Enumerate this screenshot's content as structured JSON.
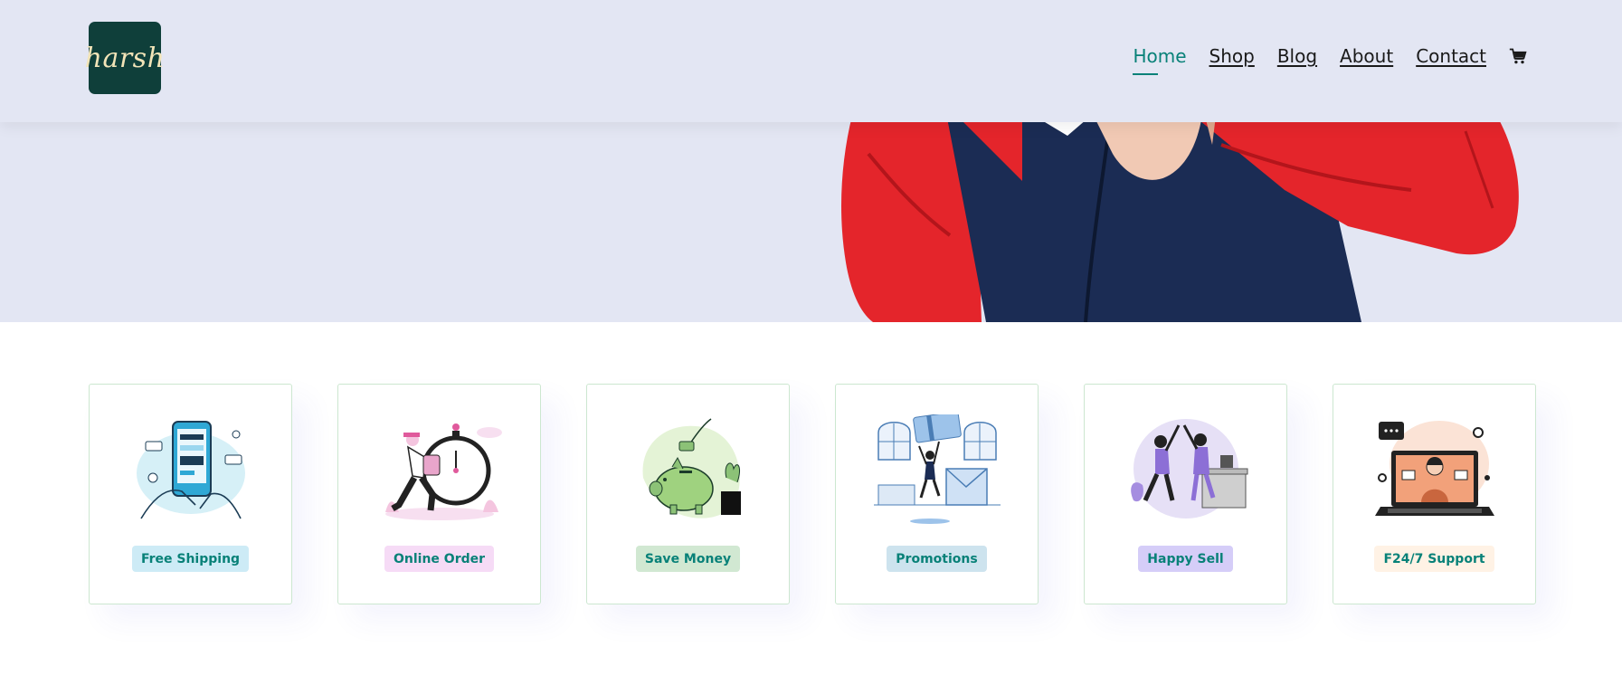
{
  "brand": {
    "logo_text": "harsh"
  },
  "nav": {
    "items": [
      {
        "label": "Home",
        "active": true
      },
      {
        "label": "Shop"
      },
      {
        "label": "Blog"
      },
      {
        "label": "About"
      },
      {
        "label": "Contact"
      }
    ],
    "cart_icon": "cart-icon"
  },
  "hero": {
    "image": "model-red-navy-jacket"
  },
  "features": [
    {
      "label": "Free Shipping",
      "icon": "phone-payment-illustration",
      "color": "#cdebf6"
    },
    {
      "label": "Online Order",
      "icon": "stopwatch-runner-illustration",
      "color": "#f6dbf6"
    },
    {
      "label": "Save Money",
      "icon": "piggy-bank-illustration",
      "color": "#d1e8d2"
    },
    {
      "label": "Promotions",
      "icon": "gift-card-illustration",
      "color": "#cdd4f8"
    },
    {
      "label": "Happy Sell",
      "icon": "high-five-illustration",
      "color": "#d5cdf8"
    },
    {
      "label": "F24/7 Support",
      "icon": "laptop-support-illustration",
      "color": "#fff2e5"
    }
  ],
  "colors": {
    "accent": "#088178",
    "header_bg": "#e3e6f3",
    "logo_bg": "#0f3f3a"
  }
}
